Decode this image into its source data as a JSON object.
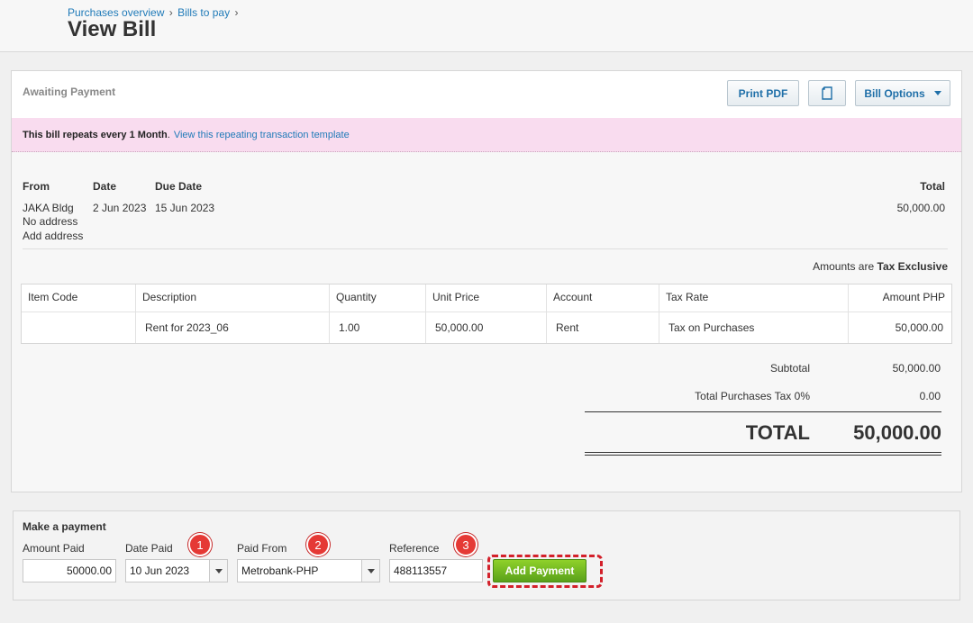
{
  "breadcrumb": {
    "items": [
      "Purchases overview",
      "Bills to pay"
    ],
    "separator": "›"
  },
  "page_title": "View Bill",
  "status": "Awaiting Payment",
  "toolbar": {
    "print_pdf": "Print PDF",
    "copy_icon": "copy-icon",
    "bill_options": "Bill Options"
  },
  "repeat": {
    "bold_text": "This bill repeats every 1 Month",
    "suffix": ".",
    "link": "View this repeating transaction template"
  },
  "bill_header": {
    "from_label": "From",
    "from_name": "JAKA Bldg",
    "from_address": "No address",
    "add_address": "Add address",
    "date_label": "Date",
    "date_value": "2 Jun 2023",
    "due_label": "Due Date",
    "due_value": "15 Jun 2023",
    "total_label": "Total",
    "total_value": "50,000.00"
  },
  "amounts_note": {
    "prefix": "Amounts are",
    "mode": "Tax Exclusive"
  },
  "line_items": {
    "headers": [
      "Item Code",
      "Description",
      "Quantity",
      "Unit Price",
      "Account",
      "Tax Rate",
      "Amount PHP"
    ],
    "rows": [
      [
        "",
        "Rent for 2023_06",
        "1.00",
        "50,000.00",
        "Rent",
        "Tax on Purchases",
        "50,000.00"
      ]
    ]
  },
  "summary": {
    "subtotal_label": "Subtotal",
    "subtotal_value": "50,000.00",
    "tax_label": "Total Purchases Tax 0%",
    "tax_value": "0.00",
    "total_label": "TOTAL",
    "total_value": "50,000.00"
  },
  "payment": {
    "title": "Make a payment",
    "amount_label": "Amount Paid",
    "amount_value": "50000.00",
    "date_label": "Date Paid",
    "date_value": "10 Jun 2023",
    "from_label": "Paid From",
    "from_value": "Metrobank-PHP",
    "ref_label": "Reference",
    "ref_value": "488113557",
    "button": "Add Payment"
  },
  "badges": [
    "1",
    "2",
    "3"
  ],
  "colors": {
    "accent_link": "#1f7ab8",
    "repeat_bar": "#f9dcef",
    "add_button": "#6ab51e",
    "badge": "#e53935",
    "highlight_outline": "#d3202a"
  }
}
